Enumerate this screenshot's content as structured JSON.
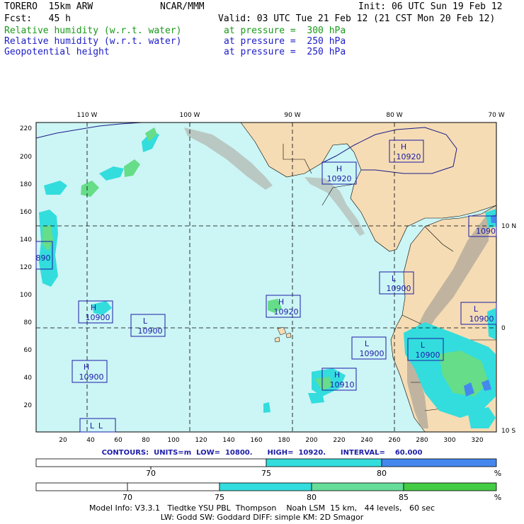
{
  "header": {
    "model": "TORERO  15km ARW",
    "org": "NCAR/MMM",
    "init": "Init: 06 UTC Sun 19 Feb 12",
    "fcst": "Fcst:   45 h",
    "valid": "Valid: 03 UTC Tue 21 Feb 12 (21 CST Mon 20 Feb 12)",
    "fields": [
      {
        "name": "Relative humidity (w.r.t. water)",
        "level": "at pressure =  300 hPa",
        "color": "#1a9a1a"
      },
      {
        "name": "Relative humidity (w.r.t. water)",
        "level": "at pressure =  250 hPa",
        "color": "#1c1cc8"
      },
      {
        "name": "Geopotential height",
        "level": "at pressure =  250 hPa",
        "color": "#1c1cc8"
      }
    ]
  },
  "map": {
    "top_lon_labels": [
      "110 W",
      "100 W",
      "90 W",
      "80 W",
      "70 W"
    ],
    "right_lat_labels": [
      "10 N",
      "0",
      "10 S"
    ],
    "y_ticks": [
      "220",
      "200",
      "180",
      "160",
      "140",
      "120",
      "100",
      "80",
      "60",
      "40",
      "20"
    ],
    "x_ticks": [
      "20",
      "40",
      "60",
      "80",
      "100",
      "120",
      "140",
      "160",
      "180",
      "200",
      "220",
      "240",
      "260",
      "280",
      "300",
      "320"
    ],
    "pressure_centers": [
      {
        "type": "H",
        "value": "10920"
      },
      {
        "type": "H",
        "value": "10920"
      },
      {
        "type": "",
        "value": "1090"
      },
      {
        "type": "",
        "value": "890"
      },
      {
        "type": "L",
        "value": "10900"
      },
      {
        "type": "H",
        "value": "10920"
      },
      {
        "type": "H",
        "value": "10900"
      },
      {
        "type": "L",
        "value": "10900"
      },
      {
        "type": "L",
        "value": "10900"
      },
      {
        "type": "L",
        "value": "10900"
      },
      {
        "type": "L",
        "value": "10900"
      },
      {
        "type": "H",
        "value": "10900"
      },
      {
        "type": "H",
        "value": "10910"
      },
      {
        "type": "L",
        "value": "L"
      }
    ],
    "colors": {
      "ocean": "#ccf5f5",
      "land": "#f5dcb4",
      "rh_cyan": "#33dddd",
      "rh_green": "#66dd88",
      "rh_blue": "#4488ee"
    }
  },
  "contours": {
    "units_label": "CONTOURS:  UNITS=m  LOW=  10800.      HIGH=  10920.      INTERVAL=    60.000"
  },
  "colorbars": [
    {
      "labels": [
        "70",
        "75",
        "80"
      ],
      "unit": "%",
      "colors": [
        "#ffffff",
        "#33dddd",
        "#4488ee"
      ]
    },
    {
      "labels": [
        "70",
        "75",
        "80",
        "85"
      ],
      "unit": "%",
      "colors": [
        "#ffffff",
        "#33dddd",
        "#66dd99",
        "#44cc44"
      ]
    }
  ],
  "footer": {
    "line1": "Model Info: V3.3.1   Tiedtke YSU PBL  Thompson    Noah LSM  15 km,   44 levels,   60 sec",
    "line2": "LW: Godd SW: Goddard DIFF: simple KM: 2D Smagor"
  }
}
